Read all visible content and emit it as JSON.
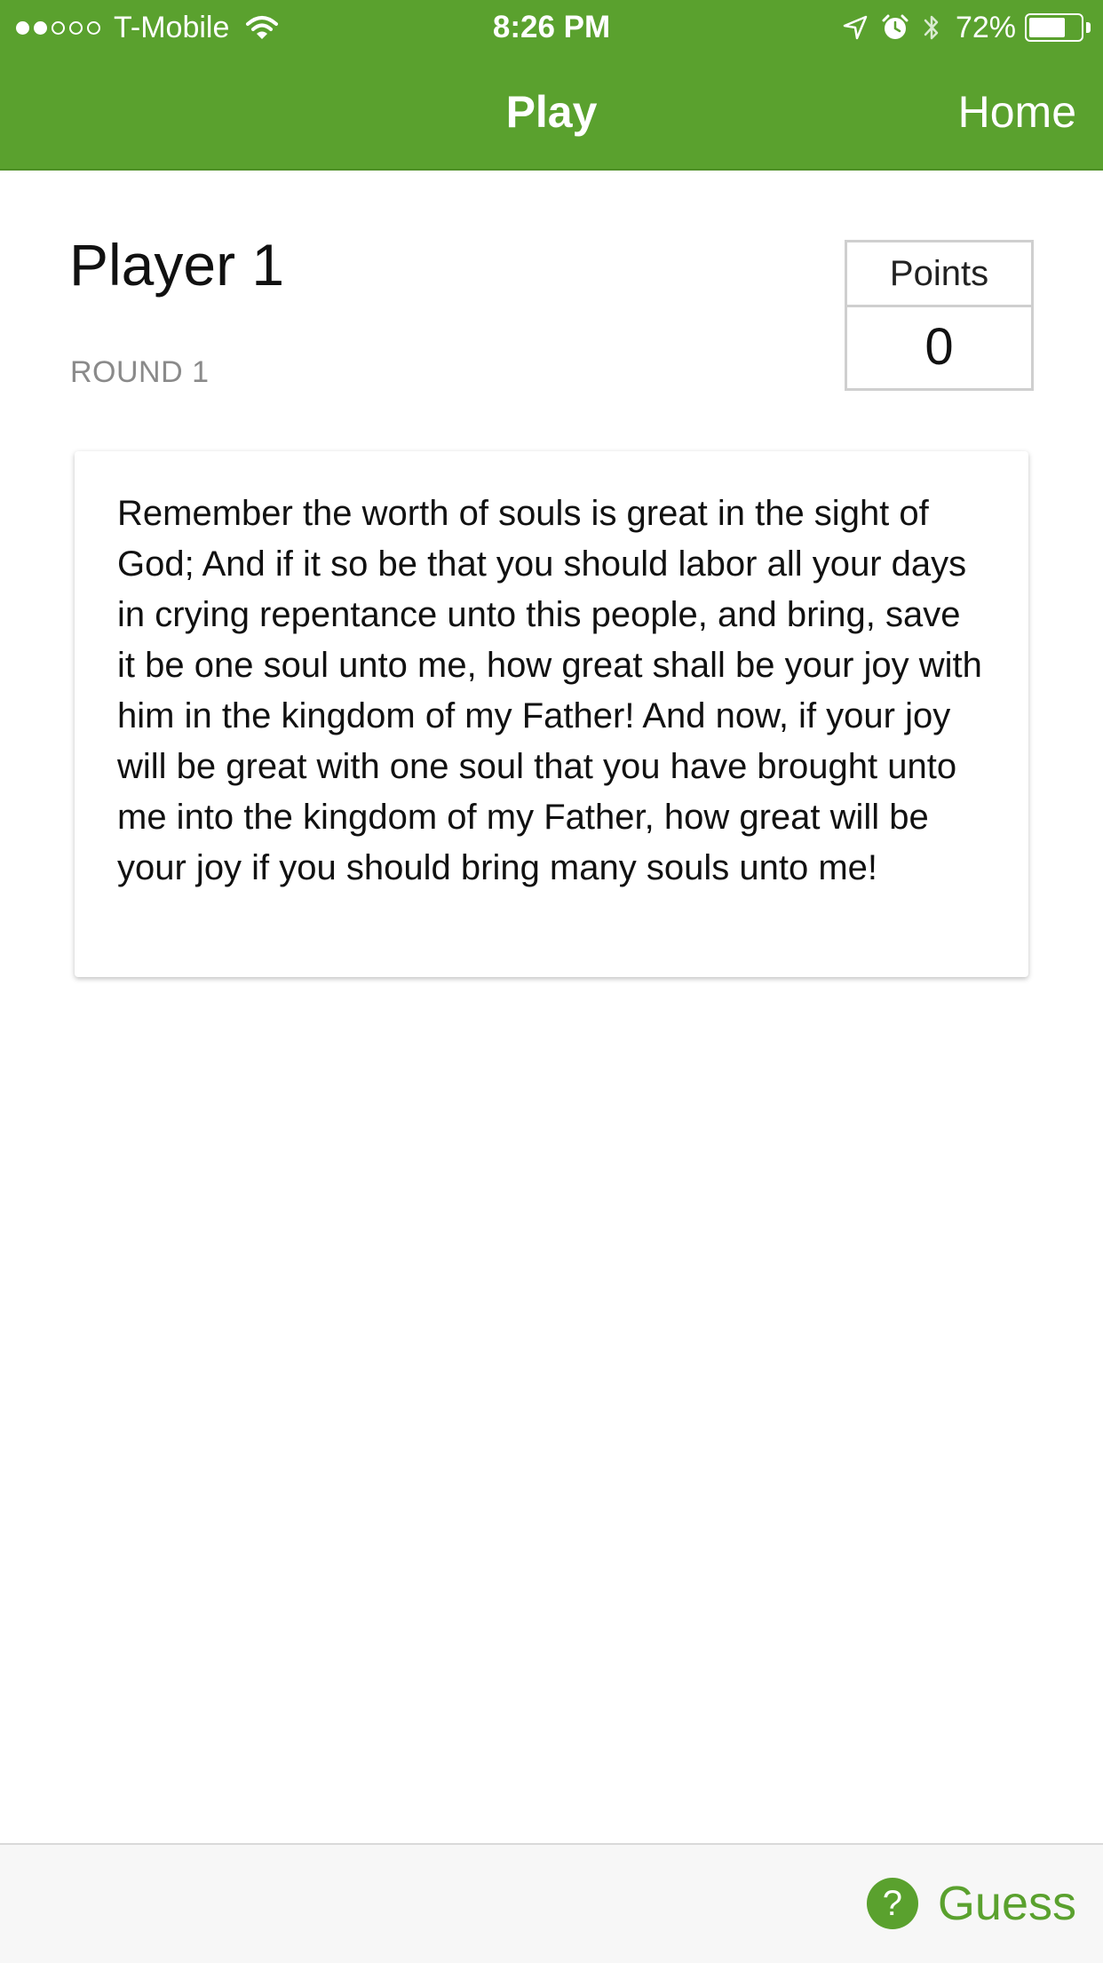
{
  "status_bar": {
    "carrier": "T-Mobile",
    "signal_bars_filled": 2,
    "signal_bars_total": 5,
    "time": "8:26 PM",
    "battery_percent": "72%",
    "battery_level": 0.72,
    "icons": [
      "wifi-icon",
      "location-arrow-icon",
      "alarm-icon",
      "bluetooth-icon",
      "battery-icon"
    ]
  },
  "nav": {
    "title": "Play",
    "home_label": "Home"
  },
  "player": {
    "name": "Player 1",
    "round": "ROUND 1"
  },
  "points": {
    "header": "Points",
    "value": "0"
  },
  "verse": {
    "text": "Remember the worth of souls is great in the sight of God; And if it so be that you should labor all your days in crying repentance unto this people, and bring, save it be one soul unto me, how great shall be your joy with him in the kingdom of my Father! And now, if your joy will be great with one soul that you have brought unto me into the kingdom of my Father, how great will be your joy if you should bring many souls unto me!"
  },
  "bottom_bar": {
    "help_icon_glyph": "?",
    "guess_label": "Guess"
  },
  "colors": {
    "accent": "#5aa12e",
    "muted_text": "#8a8a8a",
    "toolbar_bg": "#f7f7f7"
  }
}
